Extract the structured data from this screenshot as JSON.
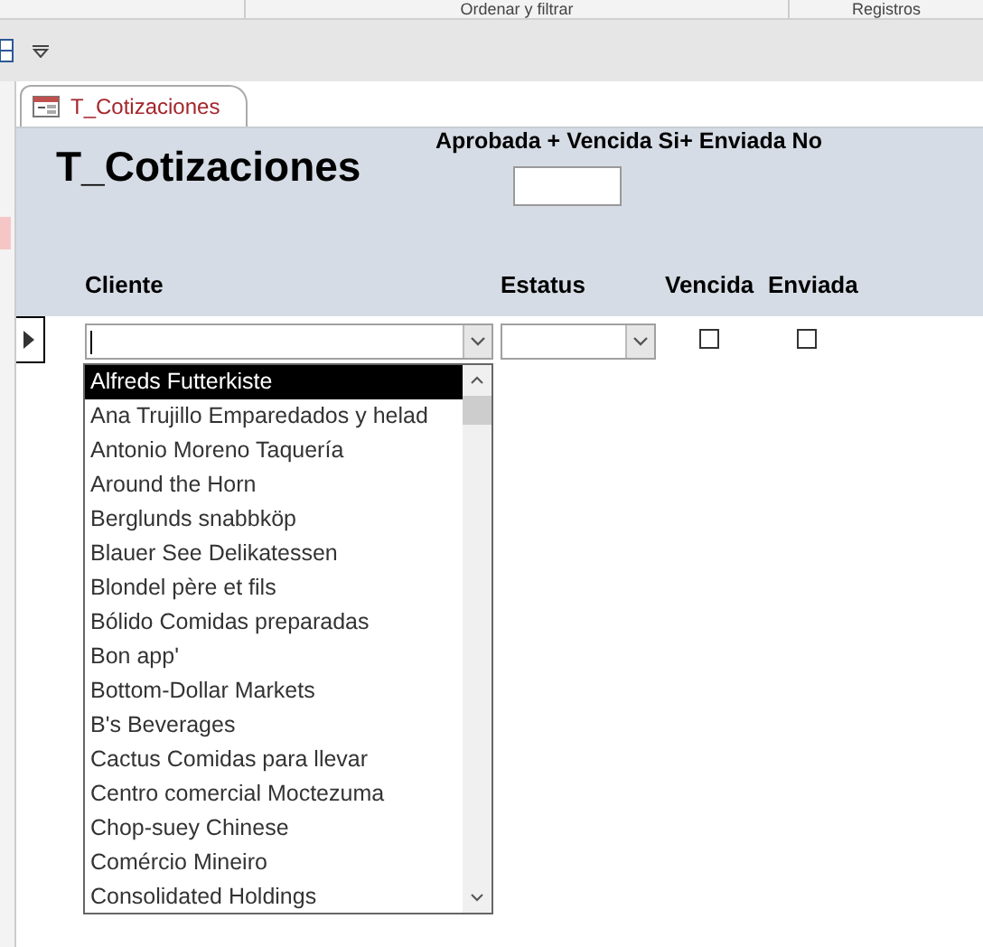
{
  "ribbon": {
    "groups": [
      "Ordenar y filtrar",
      "Registros"
    ]
  },
  "document_tab": {
    "label": "T_Cotizaciones",
    "selected": true
  },
  "form": {
    "title": "T_Cotizaciones",
    "filter_label": "Aprobada + Vencida Si+ Enviada No",
    "columns": [
      "Cliente",
      "Estatus",
      "Vencida",
      "Enviada"
    ],
    "record": {
      "vencida_checked": false,
      "enviada_checked": false
    },
    "dropdown_items": [
      {
        "label": "Alfreds Futterkiste",
        "selected": true
      },
      {
        "label": "Ana Trujillo Emparedados y helad",
        "selected": false
      },
      {
        "label": "Antonio Moreno Taquería",
        "selected": false
      },
      {
        "label": "Around the Horn",
        "selected": false
      },
      {
        "label": "Berglunds snabbköp",
        "selected": false
      },
      {
        "label": "Blauer See Delikatessen",
        "selected": false
      },
      {
        "label": "Blondel père et fils",
        "selected": false
      },
      {
        "label": "Bólido Comidas preparadas",
        "selected": false
      },
      {
        "label": "Bon app'",
        "selected": false
      },
      {
        "label": "Bottom-Dollar Markets",
        "selected": false
      },
      {
        "label": "B's Beverages",
        "selected": false
      },
      {
        "label": "Cactus Comidas para llevar",
        "selected": false
      },
      {
        "label": "Centro comercial Moctezuma",
        "selected": false
      },
      {
        "label": "Chop-suey Chinese",
        "selected": false
      },
      {
        "label": "Comércio Mineiro",
        "selected": false
      },
      {
        "label": "Consolidated Holdings",
        "selected": false
      }
    ]
  }
}
